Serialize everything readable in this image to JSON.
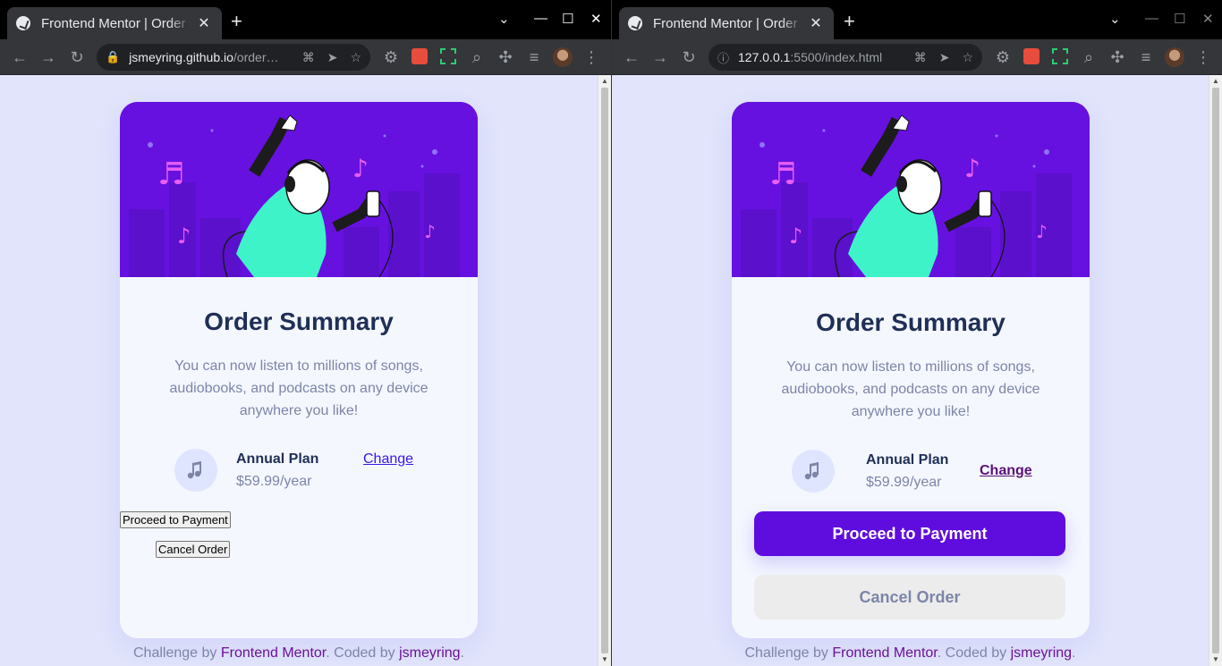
{
  "left": {
    "tab_title": "Frontend Mentor | Order summary card",
    "url_host": "jsmeyring.github.io",
    "url_path": "/order…",
    "card": {
      "title": "Order Summary",
      "description": "You can now listen to millions of songs, audiobooks, and podcasts on any device anywhere you like!",
      "plan_name": "Annual Plan",
      "plan_price": "$59.99/year",
      "change_label": "Change",
      "pay_label": "Proceed to Payment",
      "cancel_label": "Cancel Order"
    },
    "attribution": {
      "prefix": "Challenge by ",
      "fm": "Frontend Mentor",
      "mid": ". Coded by ",
      "author": "jsmeyring",
      "suffix": "."
    }
  },
  "right": {
    "tab_title": "Frontend Mentor | Order summary card",
    "url_host": "127.0.0.1",
    "url_path": ":5500/index.html",
    "card": {
      "title": "Order Summary",
      "description": "You can now listen to millions of songs, audiobooks, and podcasts on any device anywhere you like!",
      "plan_name": "Annual Plan",
      "plan_price": "$59.99/year",
      "change_label": "Change",
      "pay_label": "Proceed to Payment",
      "cancel_label": "Cancel Order"
    },
    "attribution": {
      "prefix": "Challenge by ",
      "fm": "Frontend Mentor",
      "mid": ". Coded by ",
      "author": "jsmeyring",
      "suffix": "."
    }
  },
  "icons": {
    "back": "arrow-left-icon",
    "forward": "arrow-right-icon",
    "reload": "reload-icon",
    "lock": "lock-icon",
    "info": "info-icon",
    "translate": "translate-icon",
    "send": "send-icon",
    "bookmark": "star-icon",
    "extensions": "puzzle-icon",
    "menu": "kebab-menu-icon",
    "music": "music-note-icon"
  },
  "colors": {
    "page_bg": "#e1e4fb",
    "hero_bg": "#6611e0",
    "primary": "#5f0dde",
    "title": "#1f2f56",
    "muted": "#7c85a8",
    "browser_dark": "#35363a"
  }
}
